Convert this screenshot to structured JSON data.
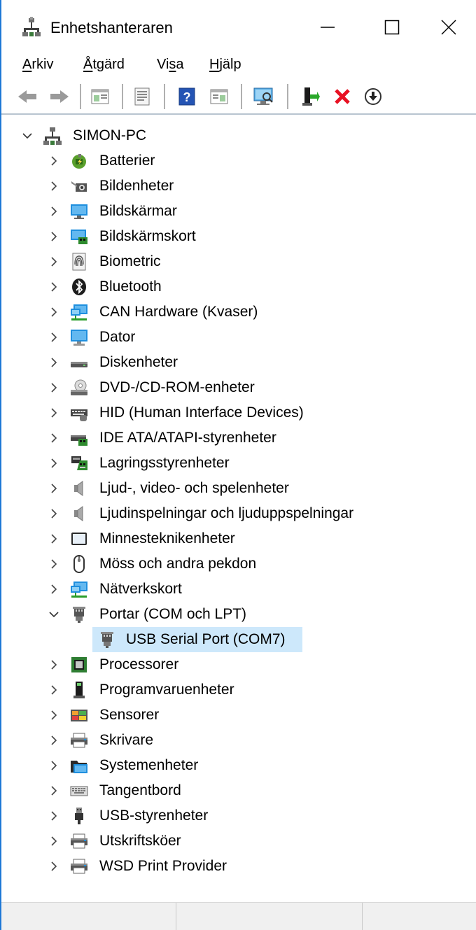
{
  "window": {
    "title": "Enhetshanteraren"
  },
  "menu": [
    {
      "label": "Arkiv",
      "hotkey_index": 0
    },
    {
      "label": "Åtgärd",
      "hotkey_index": 0
    },
    {
      "label": "Visa",
      "hotkey_index": 2
    },
    {
      "label": "Hjälp",
      "hotkey_index": 0
    }
  ],
  "toolbar": {
    "buttons": [
      "back-icon",
      "forward-icon",
      "show-hide-console-tree-icon",
      "properties-icon",
      "help-icon",
      "action-pane-icon",
      "scan-hardware-icon",
      "update-driver-icon",
      "uninstall-icon",
      "disable-device-icon"
    ]
  },
  "tree": {
    "root": "SIMON-PC",
    "categories": [
      {
        "label": "Batterier",
        "icon": "battery-icon"
      },
      {
        "label": "Bildenheter",
        "icon": "camera-icon"
      },
      {
        "label": "Bildskärmar",
        "icon": "monitor-icon"
      },
      {
        "label": "Bildskärmskort",
        "icon": "display-adapter-icon"
      },
      {
        "label": "Biometric",
        "icon": "fingerprint-icon"
      },
      {
        "label": "Bluetooth",
        "icon": "bluetooth-icon"
      },
      {
        "label": "CAN Hardware (Kvaser)",
        "icon": "network-computer-icon"
      },
      {
        "label": "Dator",
        "icon": "computer-icon"
      },
      {
        "label": "Diskenheter",
        "icon": "disk-drive-icon"
      },
      {
        "label": "DVD-/CD-ROM-enheter",
        "icon": "dvd-drive-icon"
      },
      {
        "label": "HID (Human Interface Devices)",
        "icon": "hid-icon"
      },
      {
        "label": "IDE ATA/ATAPI-styrenheter",
        "icon": "ide-controller-icon"
      },
      {
        "label": "Lagringsstyrenheter",
        "icon": "storage-controller-icon"
      },
      {
        "label": "Ljud-, video- och spelenheter",
        "icon": "speaker-icon"
      },
      {
        "label": "Ljudinspelningar och ljuduppspelningar",
        "icon": "speaker-icon"
      },
      {
        "label": "Minnesteknikenheter",
        "icon": "memory-device-icon"
      },
      {
        "label": "Möss och andra pekdon",
        "icon": "mouse-icon"
      },
      {
        "label": "Nätverkskort",
        "icon": "network-adapter-icon"
      },
      {
        "label": "Portar (COM och LPT)",
        "icon": "port-icon",
        "expanded": true,
        "children": [
          {
            "label": "USB Serial Port (COM7)",
            "icon": "port-icon",
            "selected": true
          }
        ]
      },
      {
        "label": "Processorer",
        "icon": "processor-icon"
      },
      {
        "label": "Programvaruenheter",
        "icon": "software-device-icon"
      },
      {
        "label": "Sensorer",
        "icon": "sensor-icon"
      },
      {
        "label": "Skrivare",
        "icon": "printer-icon"
      },
      {
        "label": "Systemenheter",
        "icon": "system-devices-icon"
      },
      {
        "label": "Tangentbord",
        "icon": "keyboard-icon"
      },
      {
        "label": "USB-styrenheter",
        "icon": "usb-icon"
      },
      {
        "label": "Utskriftsköer",
        "icon": "printer-icon"
      },
      {
        "label": "WSD Print Provider",
        "icon": "printer-icon"
      }
    ]
  },
  "colors": {
    "accent_border": "#1e78d6",
    "selection": "#cde8fb",
    "uninstall_red": "#e81123"
  }
}
